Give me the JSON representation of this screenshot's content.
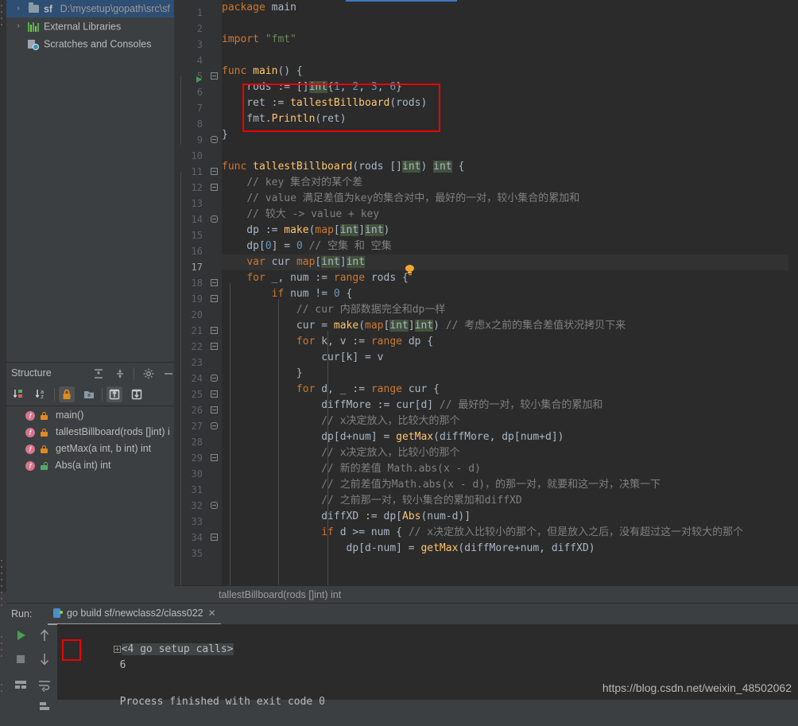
{
  "project_tree": {
    "items": [
      {
        "label": "sf",
        "sub": "D:\\mysetup\\gopath\\src\\sf",
        "arrow": "›",
        "icon": "folder-icon",
        "selected": true
      },
      {
        "label": "External Libraries",
        "sub": "",
        "arrow": "›",
        "icon": "library-icon",
        "selected": false
      },
      {
        "label": "Scratches and Consoles",
        "sub": "",
        "arrow": "",
        "icon": "scratches-icon",
        "selected": false
      }
    ]
  },
  "structure": {
    "title": "Structure",
    "header_buttons": [
      {
        "name": "expand-all-icon"
      },
      {
        "name": "collapse-all-icon"
      },
      {
        "name": "gear-icon"
      },
      {
        "name": "hide-icon"
      }
    ],
    "toolbar_buttons": [
      {
        "name": "sort-by-visibility-icon",
        "active": false
      },
      {
        "name": "sort-alphabetically-icon",
        "active": false
      },
      {
        "name": "show-non-public-icon",
        "active": true
      },
      {
        "name": "group-by-file-icon",
        "active": false
      },
      {
        "name": "show-inherited-icon",
        "active": true
      },
      {
        "name": "show-imported-icon",
        "active": false
      }
    ],
    "items": [
      {
        "label": "main()",
        "lock": "orange"
      },
      {
        "label": "tallestBillboard(rods []int) i",
        "lock": "orange"
      },
      {
        "label": "getMax(a int, b int) int",
        "lock": "orange"
      },
      {
        "label": "Abs(a int) int",
        "lock": "green"
      }
    ]
  },
  "editor": {
    "breadcrumb": "tallestBillboard(rods []int) int",
    "current_line": 17,
    "lines": [
      {
        "n": 1,
        "indent": 0,
        "html": "<span class=\"kw\">package</span> main"
      },
      {
        "n": 2,
        "indent": 0,
        "html": ""
      },
      {
        "n": 3,
        "indent": 0,
        "html": "<span class=\"kw\">import</span> <span class=\"str\">\"fmt\"</span>"
      },
      {
        "n": 4,
        "indent": 0,
        "html": ""
      },
      {
        "n": 5,
        "indent": 0,
        "html": "<span class=\"kw\">func</span> <span class=\"fn\">main</span>() {"
      },
      {
        "n": 6,
        "indent": 1,
        "html": "    rods := []<span class=\"typ\">int</span>{<span class=\"num\">1</span>, <span class=\"num\">2</span>, <span class=\"num\">3</span>, <span class=\"num\">6</span>}"
      },
      {
        "n": 7,
        "indent": 1,
        "html": "    ret := <span class=\"fn\">tallestBillboard</span>(rods)"
      },
      {
        "n": 8,
        "indent": 1,
        "html": "    fmt.<span class=\"fn\">Println</span>(ret)"
      },
      {
        "n": 9,
        "indent": 0,
        "html": "}"
      },
      {
        "n": 10,
        "indent": 0,
        "html": ""
      },
      {
        "n": 11,
        "indent": 0,
        "html": "<span class=\"kw\">func</span> <span class=\"fn\">tallestBillboard</span>(rods []<span class=\"typ\">int</span>) <span class=\"typ\">int</span> {"
      },
      {
        "n": 12,
        "indent": 1,
        "html": "    <span class=\"cmt\">// key 集合对的某个差</span>"
      },
      {
        "n": 13,
        "indent": 1,
        "html": "    <span class=\"cmt\">// value 满足差值为key的集合对中，最好的一对，较小集合的累加和</span>"
      },
      {
        "n": 14,
        "indent": 1,
        "html": "    <span class=\"cmt\">// 较大 -&gt; value + key</span>"
      },
      {
        "n": 15,
        "indent": 1,
        "html": "    dp := <span class=\"fn\">make</span>(<span class=\"kw\">map</span>[<span class=\"typ\">int</span>]<span class=\"typ\">int</span>)"
      },
      {
        "n": 16,
        "indent": 1,
        "html": "    dp[<span class=\"num\">0</span>] = <span class=\"num\">0</span> <span class=\"cmt\">// 空集 和 空集</span>"
      },
      {
        "n": 17,
        "indent": 1,
        "html": "    <span class=\"kw\">var</span> cur <span class=\"kw\">map</span>[<span class=\"typ\">int</span>]<span class=\"typ\">int</span>"
      },
      {
        "n": 18,
        "indent": 1,
        "html": "    <span class=\"kw\">for</span> _, num := <span class=\"kw\">range</span> rods {"
      },
      {
        "n": 19,
        "indent": 2,
        "html": "        <span class=\"kw\">if</span> num != <span class=\"num\">0</span> {"
      },
      {
        "n": 20,
        "indent": 3,
        "html": "            <span class=\"cmt\">// cur 内部数据完全和dp一样</span>"
      },
      {
        "n": 21,
        "indent": 3,
        "html": "            cur = <span class=\"fn\">make</span>(<span class=\"kw\">map</span>[<span class=\"typ\">int</span>]<span class=\"typ\">int</span>) <span class=\"cmt\">// 考虑x之前的集合差值状况拷贝下来</span>"
      },
      {
        "n": 22,
        "indent": 3,
        "html": "            <span class=\"kw\">for</span> k, v := <span class=\"kw\">range</span> dp {"
      },
      {
        "n": 23,
        "indent": 4,
        "html": "                cur[k] = v"
      },
      {
        "n": 24,
        "indent": 3,
        "html": "            }"
      },
      {
        "n": 25,
        "indent": 3,
        "html": "            <span class=\"kw\">for</span> d, _ := <span class=\"kw\">range</span> cur {"
      },
      {
        "n": 26,
        "indent": 4,
        "html": "                diffMore := cur[d] <span class=\"cmt\">// 最好的一对，较小集合的累加和</span>"
      },
      {
        "n": 27,
        "indent": 4,
        "html": "                <span class=\"cmt\">// x决定放入，比较大的那个</span>"
      },
      {
        "n": 28,
        "indent": 4,
        "html": "                dp[d+num] = <span class=\"fn\">getMax</span>(diffMore, dp[num+d])"
      },
      {
        "n": 29,
        "indent": 4,
        "html": "                <span class=\"cmt\">// x决定放入，比较小的那个</span>"
      },
      {
        "n": 30,
        "indent": 4,
        "html": "                <span class=\"cmt\">// 新的差值 Math.abs(x - d)</span>"
      },
      {
        "n": 31,
        "indent": 4,
        "html": "                <span class=\"cmt\">// 之前差值为Math.abs(x - d)，的那一对，就要和这一对，决策一下</span>"
      },
      {
        "n": 32,
        "indent": 4,
        "html": "                <span class=\"cmt\">// 之前那一对，较小集合的累加和diffXD</span>"
      },
      {
        "n": 33,
        "indent": 4,
        "html": "                diffXD := dp[<span class=\"fn\">Abs</span>(num-d)]"
      },
      {
        "n": 34,
        "indent": 4,
        "html": "                <span class=\"kw\">if</span> d &gt;= num { <span class=\"cmt\">// x决定放入比较小的那个，但是放入之后，没有超过这一对较大的那个</span>"
      },
      {
        "n": 35,
        "indent": 5,
        "html": "                    dp[d-num] = <span class=\"fn\">getMax</span>(diffMore+num, diffXD)"
      }
    ],
    "highlight_box": {
      "label": "code-highlight-rectangle"
    }
  },
  "run_window": {
    "run_label": "Run:",
    "tab_title": "go build sf/newclass2/class022",
    "close_label": "✕",
    "sidebar_buttons": [
      {
        "name": "rerun-button"
      },
      {
        "name": "stop-button"
      },
      {
        "name": "print-button"
      },
      {
        "name": "up-stack-button"
      },
      {
        "name": "down-stack-button"
      },
      {
        "name": "soft-wrap-button"
      },
      {
        "name": "scroll-to-end-button"
      }
    ],
    "console_lines": [
      {
        "text": "<4 go setup calls>",
        "collapsed": true
      },
      {
        "text": "6",
        "highlight": true
      },
      {
        "text": ""
      },
      {
        "text": "Process finished with exit code 0"
      }
    ]
  },
  "watermark": "https://blog.csdn.net/weixin_48502062",
  "colors": {
    "panel_bg": "#3c3f41",
    "editor_bg": "#2b2b2b",
    "gutter_bg": "#313335",
    "selection_blue": "#2f4e73",
    "tab_accent": "#3d79bc",
    "highlight_red": "#ee0000",
    "keyword": "#cc7832",
    "function": "#ffc66d",
    "string": "#6a8759",
    "number": "#6897bb",
    "comment": "#808080",
    "text": "#a9b7c6"
  }
}
